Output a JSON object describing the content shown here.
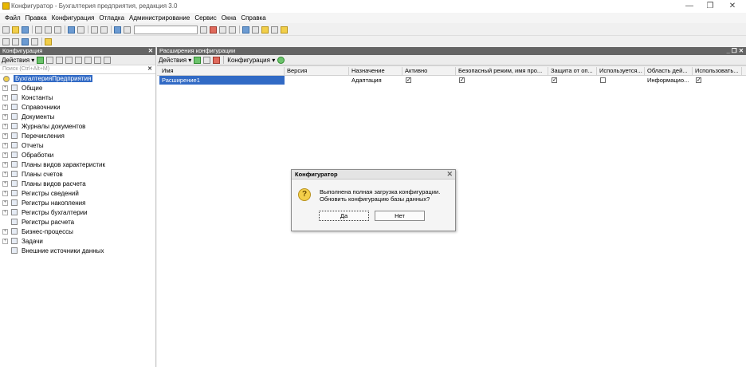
{
  "window": {
    "title": "Конфигуратор - Бухгалтерия предприятия, редакция 3.0",
    "minimize": "—",
    "restore": "❐",
    "close": "✕"
  },
  "menu": [
    "Файл",
    "Правка",
    "Конфигурация",
    "Отладка",
    "Администрирование",
    "Сервис",
    "Окна",
    "Справка"
  ],
  "left_panel": {
    "title": "Конфигурация",
    "pin": "⁴",
    "close": "✕",
    "actions_label": "Действия ▾",
    "search_placeholder": "Поиск (Ctrl+Alt+M)",
    "search_clear": "✕",
    "root": "БухгалтерияПредприятия",
    "items": [
      {
        "label": "Общие",
        "expandable": true
      },
      {
        "label": "Константы",
        "expandable": true
      },
      {
        "label": "Справочники",
        "expandable": true
      },
      {
        "label": "Документы",
        "expandable": true
      },
      {
        "label": "Журналы документов",
        "expandable": true
      },
      {
        "label": "Перечисления",
        "expandable": true
      },
      {
        "label": "Отчеты",
        "expandable": true
      },
      {
        "label": "Обработки",
        "expandable": true
      },
      {
        "label": "Планы видов характеристик",
        "expandable": true
      },
      {
        "label": "Планы счетов",
        "expandable": true
      },
      {
        "label": "Планы видов расчета",
        "expandable": true
      },
      {
        "label": "Регистры сведений",
        "expandable": true
      },
      {
        "label": "Регистры накопления",
        "expandable": true
      },
      {
        "label": "Регистры бухгалтерии",
        "expandable": true
      },
      {
        "label": "Регистры расчета",
        "expandable": false
      },
      {
        "label": "Бизнес-процессы",
        "expandable": true
      },
      {
        "label": "Задачи",
        "expandable": true
      },
      {
        "label": "Внешние источники данных",
        "expandable": false
      }
    ],
    "plus_sign": "+"
  },
  "right_panel": {
    "title": "Расширения конфигурации",
    "controls": "_ ❐ ✕",
    "actions_label": "Действия ▾",
    "config_label": "Конфигурация ▾",
    "columns": [
      "Имя",
      "Версия",
      "Назначение",
      "Активно",
      "Безопасный режим, имя про...",
      "Защита от оп...",
      "Используется...",
      "Область дей...",
      "Использовать..."
    ],
    "rows": [
      {
        "name": "Расширение1",
        "version": "",
        "purpose": "Адаптация",
        "active": true,
        "safe_mode": true,
        "protection": true,
        "used": false,
        "scope": "Информацио...",
        "use": true
      }
    ]
  },
  "dialog": {
    "title": "Конфигуратор",
    "close": "✕",
    "icon": "?",
    "line1": "Выполнена полная загрузка конфигурации.",
    "line2": "Обновить конфигурацию базы данных?",
    "yes": "Да",
    "no": "Нет"
  },
  "colors": {
    "selection": "#316ac5",
    "panel_header": "#646464"
  },
  "check_mark": "✓"
}
